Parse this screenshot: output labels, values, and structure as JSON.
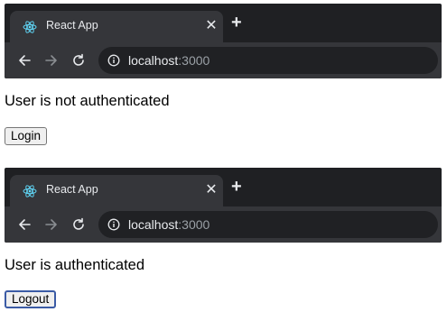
{
  "screens": [
    {
      "tab_title": "React App",
      "url_host": "localhost",
      "url_port": ":3000",
      "status_text": "User is not authenticated",
      "button_label": "Login"
    },
    {
      "tab_title": "React App",
      "url_host": "localhost",
      "url_port": ":3000",
      "status_text": "User is authenticated",
      "button_label": "Logout"
    }
  ],
  "icons": {
    "favicon": "react-icon",
    "back": "arrow-left-icon",
    "forward": "arrow-right-icon",
    "reload": "reload-icon",
    "site_info": "info-icon",
    "close_tab": "close-icon",
    "new_tab": "plus-icon"
  },
  "colors": {
    "titlebar": "#1f2023",
    "tab_active": "#35363a",
    "omnibox": "#202124",
    "react_cyan": "#61dafb"
  }
}
